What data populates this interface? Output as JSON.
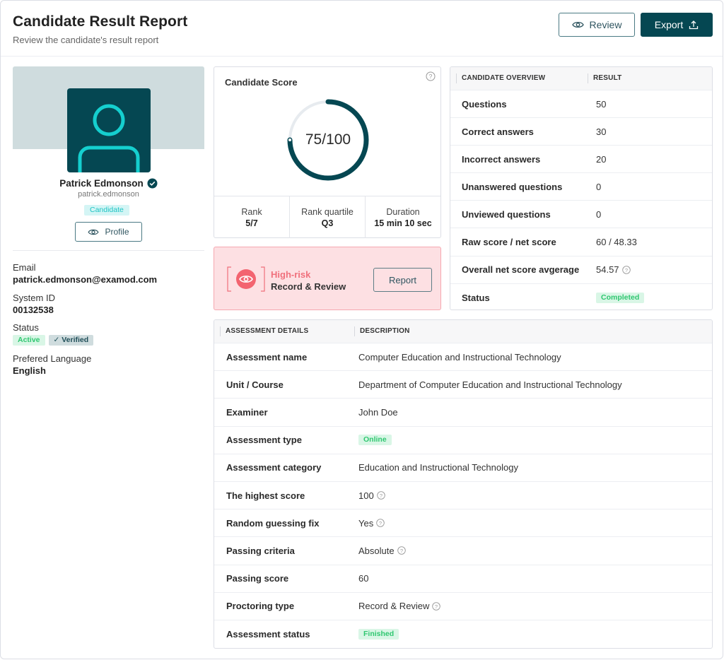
{
  "header": {
    "title": "Candidate Result Report",
    "subtitle": "Review the candidate's result report",
    "review_label": "Review",
    "export_label": "Export"
  },
  "profile": {
    "name": "Patrick Edmonson",
    "username": "patrick.edmonson",
    "role_badge": "Candidate",
    "profile_button": "Profile",
    "fields": {
      "email_label": "Email",
      "email_value": "patrick.edmonson@examod.com",
      "system_id_label": "System ID",
      "system_id_value": "00132538",
      "status_label": "Status",
      "status_active": "Active",
      "status_verified": "Verified",
      "language_label": "Prefered Language",
      "language_value": "English"
    }
  },
  "score": {
    "title": "Candidate Score",
    "display": "75/100",
    "value": 75,
    "max": 100,
    "stats": [
      {
        "label": "Rank",
        "value": "5/7"
      },
      {
        "label": "Rank quartile",
        "value": "Q3"
      },
      {
        "label": "Duration",
        "value": "15 min 10 sec"
      }
    ]
  },
  "risk": {
    "level": "High-risk",
    "proctoring": "Record & Review",
    "report_button": "Report"
  },
  "overview": {
    "headers": [
      "CANDIDATE OVERVIEW",
      "RESULT"
    ],
    "rows": [
      {
        "key": "Questions",
        "value": "50"
      },
      {
        "key": "Correct answers",
        "value": "30"
      },
      {
        "key": "Incorrect answers",
        "value": "20"
      },
      {
        "key": "Unanswered questions",
        "value": "0"
      },
      {
        "key": "Unviewed questions",
        "value": "0"
      },
      {
        "key": "Raw score / net score",
        "value": "60 / 48.33"
      },
      {
        "key": "Overall net score avgerage",
        "value": "54.57",
        "help": true
      },
      {
        "key": "Status",
        "value": "Completed",
        "badge": true
      }
    ]
  },
  "details": {
    "headers": [
      "ASSESSMENT DETAILS",
      "DESCRIPTION"
    ],
    "rows": [
      {
        "key": "Assessment name",
        "value": "Computer Education and Instructional Technology"
      },
      {
        "key": "Unit / Course",
        "value": "Department of Computer Education and Instructional Technology"
      },
      {
        "key": "Examiner",
        "value": "John Doe"
      },
      {
        "key": "Assessment type",
        "value": "Online",
        "badge": true
      },
      {
        "key": "Assessment category",
        "value": "Education and Instructional Technology"
      },
      {
        "key": "The highest score",
        "value": "100",
        "help": true
      },
      {
        "key": "Random guessing fix",
        "value": "Yes",
        "help": true
      },
      {
        "key": "Passing criteria",
        "value": "Absolute",
        "help": true
      },
      {
        "key": "Passing score",
        "value": "60"
      },
      {
        "key": "Proctoring type",
        "value": "Record & Review",
        "help": true
      },
      {
        "key": "Assessment status",
        "value": "Finished",
        "badge": true
      }
    ]
  },
  "colors": {
    "brand": "#054752",
    "accent_cyan": "#1ec4c4",
    "success": "#2fc770",
    "danger": "#f0707c"
  }
}
